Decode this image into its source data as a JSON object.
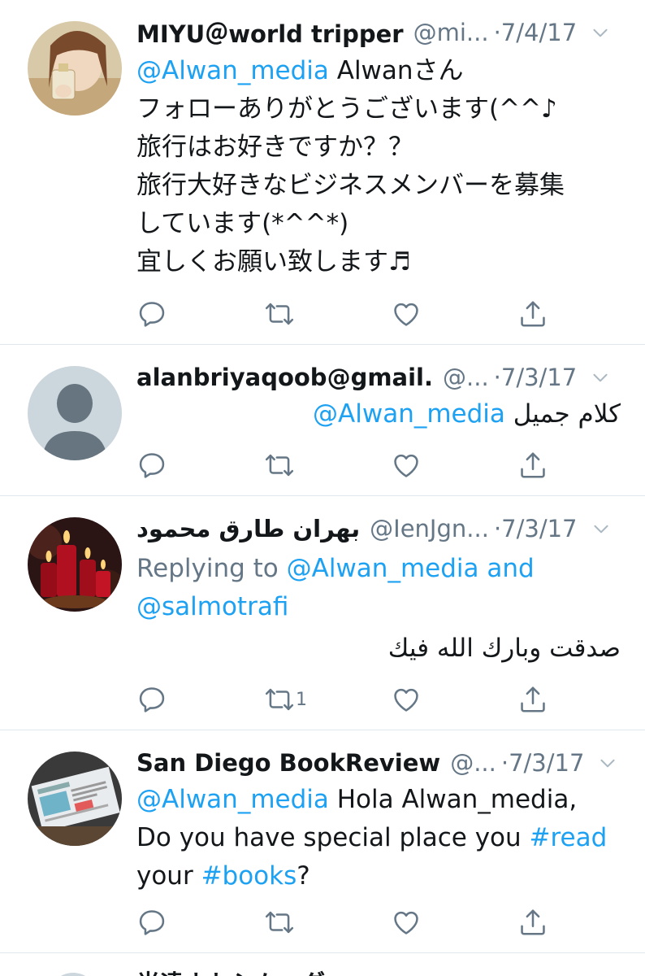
{
  "tweets": [
    {
      "name": "MIYU＠world tripper",
      "handle": "@mi...",
      "date": "·7/4/17",
      "mention": "@Alwan_media",
      "lines": [
        "Alwanさん",
        "フォローありがとうございます(^^♪",
        "旅行はお好きですか？？",
        "旅行大好きなビジネスメンバーを募集",
        "しています(*^^*)",
        "宜しくお願い致します♬"
      ],
      "avatar": "photo-avatar-woman"
    },
    {
      "name": "alanbriyaqoob@gmail.",
      "handle": "@...",
      "date": "·7/3/17",
      "mention": "@Alwan_media",
      "text": "كلام جميل",
      "avatar": "default-avatar"
    },
    {
      "name": "بهران طارق محمود",
      "handle": "@IenJgn...",
      "date": "·7/3/17",
      "reply_prefix": "Replying to ",
      "reply_user1": "@Alwan_media",
      "reply_and": " and",
      "reply_user2": "@salmotrafi",
      "text": "صدقت وبارك الله فيك",
      "retweet_count": "1",
      "avatar": "candles-avatar"
    },
    {
      "name": "San Diego BookReview",
      "handle": "@...",
      "date": "·7/3/17",
      "mention": "@Alwan_media",
      "line1_rest": " Hola Alwan_media,",
      "line2_text": "Do you have special place you ",
      "hashtag1": "#read",
      "line3_text": "your ",
      "hashtag2": "#books",
      "line3_end": "?",
      "avatar": "newspaper-avatar"
    }
  ],
  "partial_next": {
    "name": "光遠ナトシム・ダ..."
  },
  "icons": {
    "reply": "reply-icon",
    "retweet": "retweet-icon",
    "like": "like-icon",
    "share": "share-icon",
    "caret": "chevron-down-icon"
  },
  "colors": {
    "link": "#1da1f2",
    "muted": "#657786",
    "text": "#14171a",
    "divider": "#e1e8ed"
  }
}
